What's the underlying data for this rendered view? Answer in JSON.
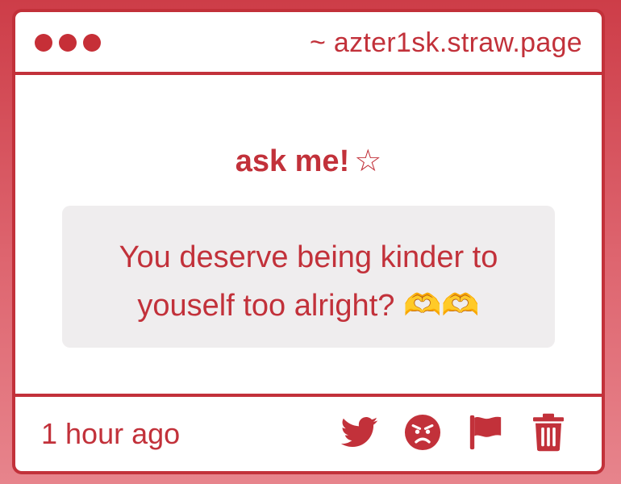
{
  "window": {
    "url": "~ azter1sk.straw.page"
  },
  "card": {
    "heading": "ask me!",
    "heading_star": "☆",
    "question_line1": "You deserve being kinder to",
    "question_line2": "youself too alright? 🫶🫶"
  },
  "footer": {
    "timestamp": "1 hour ago",
    "actions": [
      "twitter-icon",
      "angry-face-icon",
      "flag-icon",
      "trash-icon"
    ]
  },
  "colors": {
    "accent": "#c2313a",
    "box_background": "#efedee",
    "page_background": "#d9535d"
  }
}
